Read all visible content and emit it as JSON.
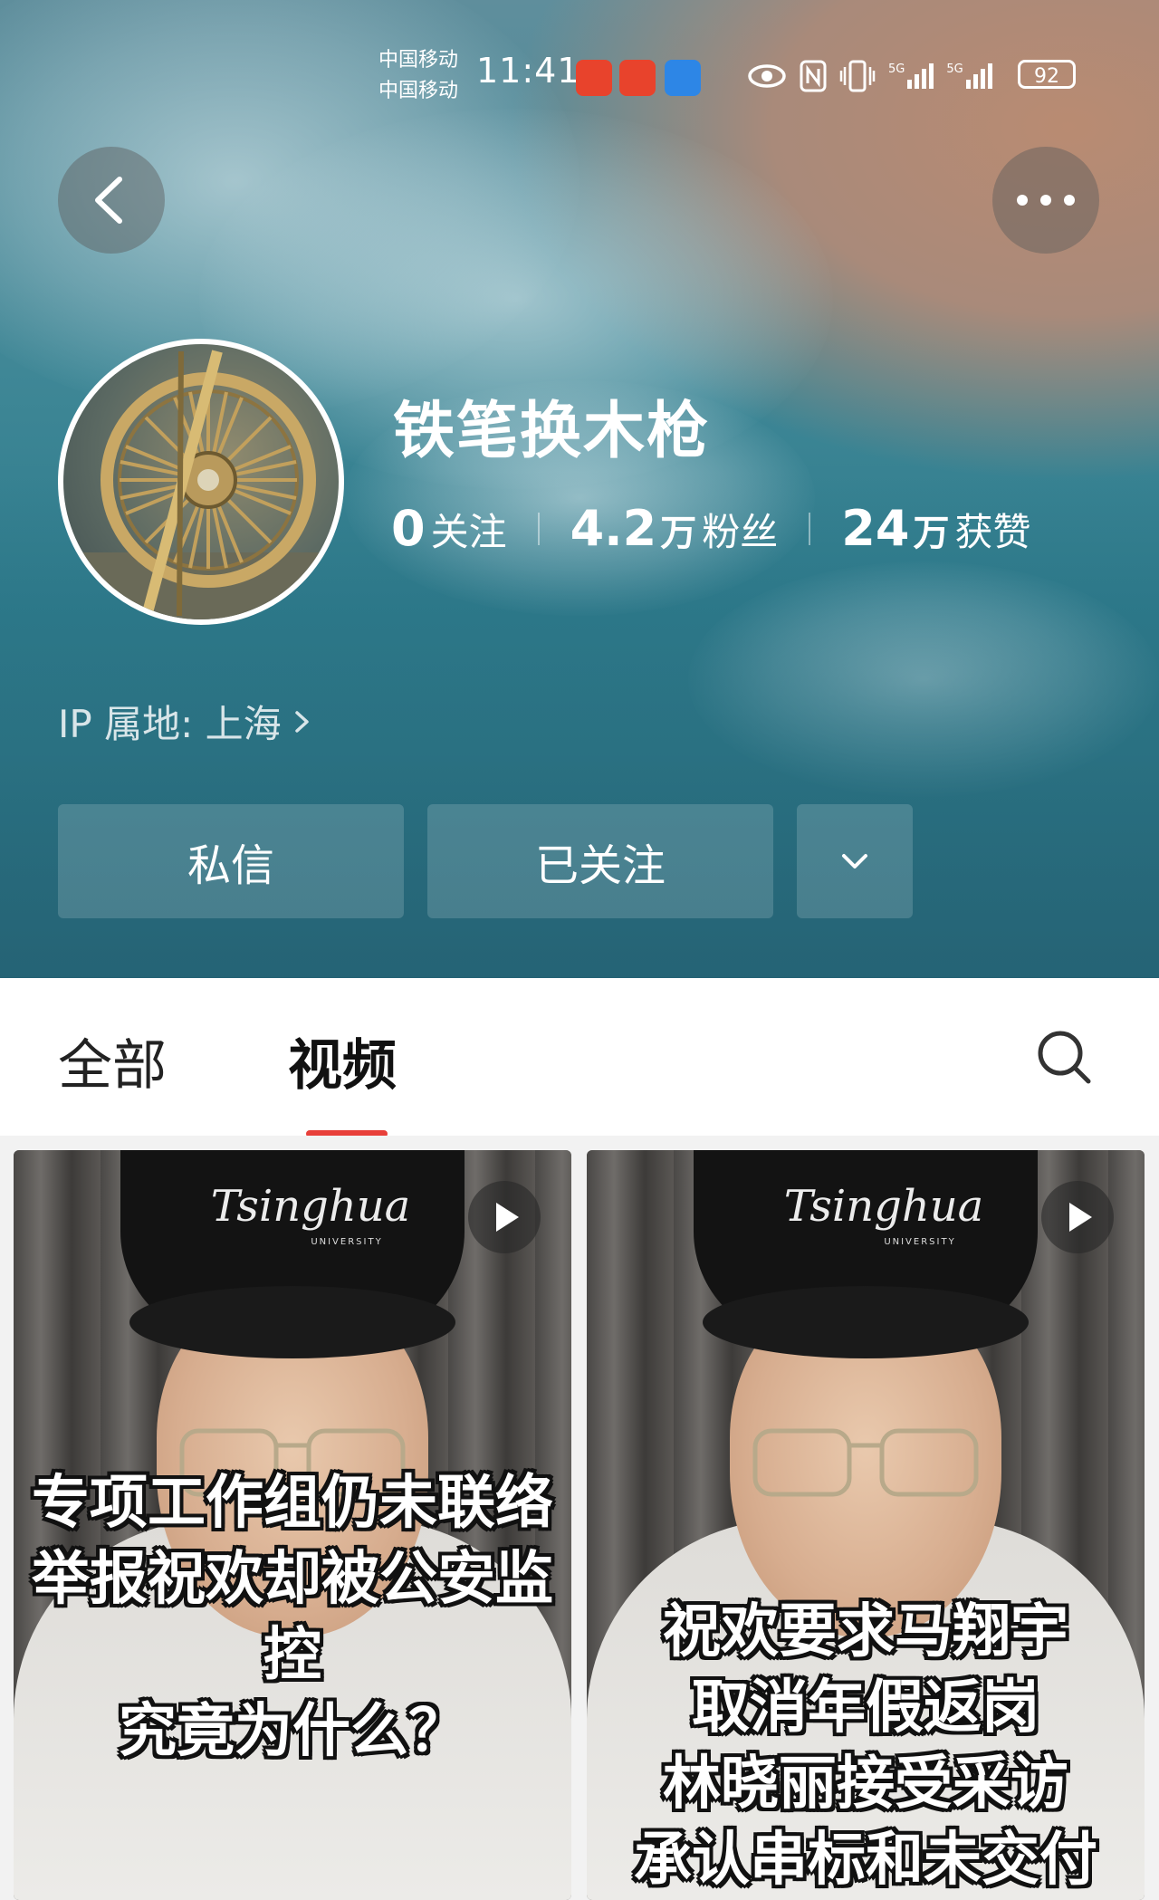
{
  "statusbar": {
    "carrier_1": "中国移动",
    "carrier_2": "中国移动",
    "time": "11:41",
    "battery": "92",
    "network_1": "5G",
    "network_2": "5G"
  },
  "profile": {
    "name": "铁笔换木枪",
    "following_count": "0",
    "following_label": "关注",
    "followers_count": "4.2",
    "followers_unit": "万",
    "followers_label": "粉丝",
    "likes_count": "24",
    "likes_unit": "万",
    "likes_label": "获赞",
    "ip_location": "IP 属地: 上海"
  },
  "actions": {
    "message_label": "私信",
    "follow_label": "已关注"
  },
  "tabs": {
    "all_label": "全部",
    "video_label": "视频"
  },
  "videos": [
    {
      "cap_text": "Tsinghua",
      "cap_sub": "UNIVERSITY",
      "caption_lines": [
        "专项工作组仍未联络",
        "举报祝欢却被公安监控",
        "究竟为什么？"
      ]
    },
    {
      "cap_text": "Tsinghua",
      "cap_sub": "UNIVERSITY",
      "caption_lines": [
        "祝欢要求马翔宇",
        "取消年假返岗",
        "林晓丽接受采访",
        "承认串标和未交付"
      ]
    }
  ],
  "colors": {
    "accent_red": "#e8403a",
    "header_teal": "#2f7c8d"
  },
  "icons": [
    "back-icon",
    "more-icon",
    "chevron-right-icon",
    "chevron-down-icon",
    "search-icon",
    "play-icon",
    "eye-icon",
    "nfc-icon",
    "vibrate-icon",
    "signal-icon",
    "battery-icon"
  ]
}
